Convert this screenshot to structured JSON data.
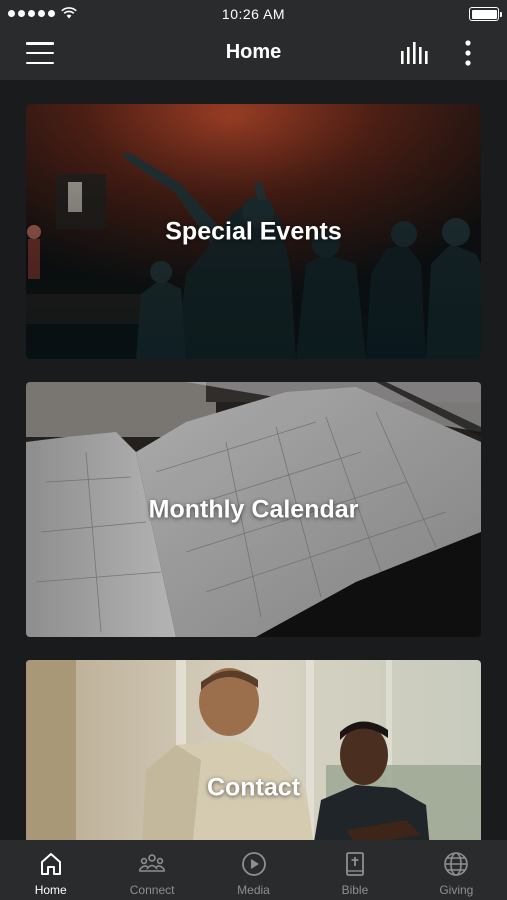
{
  "status_bar": {
    "time": "10:26 AM"
  },
  "header": {
    "title": "Home"
  },
  "cards": [
    {
      "title": "Special Events"
    },
    {
      "title": "Monthly Calendar"
    },
    {
      "title": "Contact"
    }
  ],
  "tabs": [
    {
      "label": "Home",
      "icon": "home-icon",
      "active": true
    },
    {
      "label": "Connect",
      "icon": "people-icon",
      "active": false
    },
    {
      "label": "Media",
      "icon": "play-icon",
      "active": false
    },
    {
      "label": "Bible",
      "icon": "bible-icon",
      "active": false
    },
    {
      "label": "Giving",
      "icon": "globe-icon",
      "active": false
    }
  ],
  "colors": {
    "bar_background": "#2a2b2d",
    "page_background": "#1a1b1d",
    "active_tab": "#ffffff",
    "inactive_tab": "#8e8f92"
  }
}
